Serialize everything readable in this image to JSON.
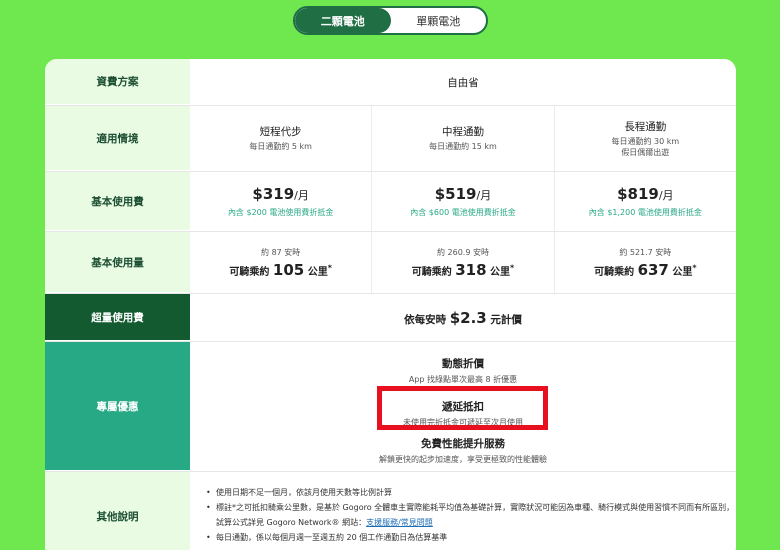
{
  "toggle": {
    "options": [
      "二顆電池",
      "單顆電池"
    ]
  },
  "rows": {
    "plan": {
      "label": "資費方案",
      "value": "自由省"
    },
    "usage": {
      "label": "適用情境",
      "items": [
        {
          "title": "短程代步",
          "sub1": "每日通勤約 5 km",
          "sub2": ""
        },
        {
          "title": "中程通勤",
          "sub1": "每日通勤約 15 km",
          "sub2": ""
        },
        {
          "title": "長程通勤",
          "sub1": "每日通勤約 30 km",
          "sub2": "假日偶爾出遊"
        }
      ]
    },
    "base_fee": {
      "label": "基本使用費",
      "items": [
        {
          "price": "$319",
          "unit": "/月",
          "discount": "內含 $200 電池使用費折抵金"
        },
        {
          "price": "$519",
          "unit": "/月",
          "discount": "內含 $600 電池使用費折抵金"
        },
        {
          "price": "$819",
          "unit": "/月",
          "discount": "內含 $1,200 電池使用費折抵金"
        }
      ]
    },
    "base_usage": {
      "label": "基本使用量",
      "items": [
        {
          "hours": "約 87 安時",
          "prefix": "可騎乘約",
          "km": "105",
          "suffix": "公里",
          "mark": "*"
        },
        {
          "hours": "約 260.9 安時",
          "prefix": "可騎乘約",
          "km": "318",
          "suffix": "公里",
          "mark": "*"
        },
        {
          "hours": "約 521.7 安時",
          "prefix": "可騎乘約",
          "km": "637",
          "suffix": "公里",
          "mark": "*"
        }
      ]
    },
    "overage": {
      "label": "超量使用費",
      "prefix": "依每安時",
      "price": "$2.3",
      "suffix": "元計價"
    },
    "perks": {
      "label": "專屬優惠",
      "items": [
        {
          "title": "動態折價",
          "desc": "App 找綠點單次最高 8 折優惠"
        },
        {
          "title": "遞延抵扣",
          "desc": "未使用完折抵金可遞延至次月使用"
        },
        {
          "title": "免費性能提升服務",
          "desc": "解鎖更快的起步加速度，享受更極致的性能體驗"
        }
      ]
    },
    "notes": {
      "label": "其他說明",
      "items": [
        "使用日期不足一個月，依該月使用天數等比例計算",
        "標註*之可抵扣騎乘公里數，是基於 Gogoro 全體車主實際能耗平均值為基礎計算，實際狀況可能因為車種、騎行模式與使用習慣不同而有所區別， 試算公式詳見 Gogoro Network® 網站：",
        "每日通勤，係以每個月週一至週五約 20 個工作通勤日為估算基準"
      ],
      "link": "支援服務/常見問題"
    }
  }
}
